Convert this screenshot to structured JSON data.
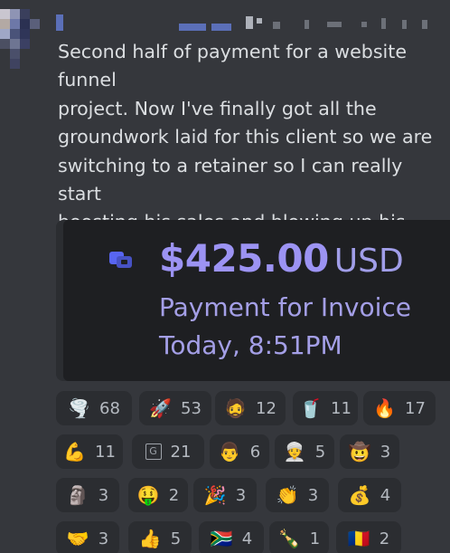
{
  "message": {
    "text": "Second half of payment for a website funnel\nproject. Now I've finally got all the\ngroundwork laid for this client so we are\nswitching to a retainer so I can really start\nboosting his sales and blowing up his\nbusiness",
    "trailing_emojis": [
      "💥",
      "🌪️"
    ]
  },
  "embed": {
    "icon": "payment-app-icon",
    "amount": "$425.00",
    "currency": "USD",
    "description": "Payment for Invoice",
    "timestamp": "Today, 8:51PM"
  },
  "reactions": [
    {
      "emoji": "🌪️",
      "count": "68"
    },
    {
      "emoji": "🚀",
      "count": "53"
    },
    {
      "emoji": "🧔",
      "count": "12"
    },
    {
      "emoji": "🥤",
      "count": "11"
    },
    {
      "emoji": "🔥",
      "count": "17"
    },
    {
      "emoji": "💪",
      "count": "11"
    },
    {
      "emoji": "G",
      "count": "21"
    },
    {
      "emoji": "👨",
      "count": "6"
    },
    {
      "emoji": "👳",
      "count": "5"
    },
    {
      "emoji": "🤠",
      "count": "3"
    },
    {
      "emoji": "🗿",
      "count": "3"
    },
    {
      "emoji": "🤑",
      "count": "2"
    },
    {
      "emoji": "🎉",
      "count": "3"
    },
    {
      "emoji": "👏",
      "count": "3"
    },
    {
      "emoji": "💰",
      "count": "4"
    },
    {
      "emoji": "🤝",
      "count": "3"
    },
    {
      "emoji": "👍",
      "count": "5"
    },
    {
      "emoji": "🇿🇦",
      "count": "4"
    },
    {
      "emoji": "🍾",
      "count": "1"
    },
    {
      "emoji": "🇷🇴",
      "count": "2"
    }
  ],
  "colors": {
    "background": "#35373c",
    "embed_background": "#1e1f22",
    "accent_amount": "#9c93f3",
    "reaction_background": "#2b2d31"
  }
}
